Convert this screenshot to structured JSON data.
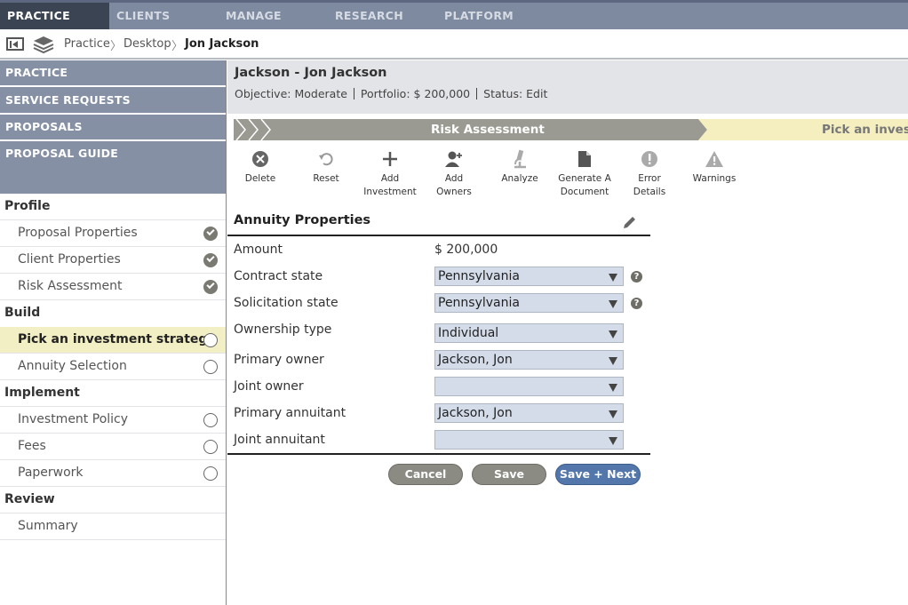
{
  "topnav": {
    "tabs": [
      {
        "label": "PRACTICE"
      },
      {
        "label": "CLIENTS"
      },
      {
        "label": "MANAGE"
      },
      {
        "label": "RESEARCH"
      },
      {
        "label": "PLATFORM"
      }
    ]
  },
  "breadcrumb": {
    "items": [
      "Practice",
      "Desktop",
      "Jon Jackson"
    ]
  },
  "sidebar": {
    "heads": [
      "PRACTICE",
      "SERVICE REQUESTS",
      "PROPOSALS",
      "PROPOSAL GUIDE"
    ],
    "sections": {
      "profile": "Profile",
      "build": "Build",
      "implement": "Implement",
      "review": "Review"
    },
    "items": [
      {
        "label": "Proposal Properties",
        "status": "done"
      },
      {
        "label": "Client Properties",
        "status": "done"
      },
      {
        "label": "Risk Assessment",
        "status": "done"
      },
      {
        "label": "Pick an investment strategy",
        "status": "empty"
      },
      {
        "label": "Annuity Selection",
        "status": "empty"
      },
      {
        "label": "Investment Policy",
        "status": "empty"
      },
      {
        "label": "Fees",
        "status": "empty"
      },
      {
        "label": "Paperwork",
        "status": "empty"
      },
      {
        "label": "Summary",
        "status": "none"
      }
    ]
  },
  "header": {
    "title": "Jackson - Jon Jackson",
    "objective": "Objective: Moderate",
    "portfolio": "Portfolio: $ 200,000",
    "status": "Status: Edit"
  },
  "progress": {
    "done_step": "Risk Assessment",
    "current_step": "Pick an invest"
  },
  "toolbar": {
    "delete": "Delete",
    "reset": "Reset",
    "add_investment": "Add Investment",
    "add_owners": "Add Owners",
    "analyze": "Analyze",
    "generate_document": "Generate A Document",
    "error_details": "Error Details",
    "warnings": "Warnings"
  },
  "form": {
    "title": "Annuity Properties",
    "amount_label": "Amount",
    "amount_value": "$ 200,000",
    "contract_state_label": "Contract state",
    "contract_state_value": "Pennsylvania",
    "solicitation_state_label": "Solicitation state",
    "solicitation_state_value": "Pennsylvania",
    "ownership_type_label": "Ownership type",
    "ownership_type_value": "Individual",
    "primary_owner_label": "Primary owner",
    "primary_owner_value": "Jackson, Jon",
    "joint_owner_label": "Joint owner",
    "joint_owner_value": "",
    "primary_annuitant_label": "Primary annuitant",
    "primary_annuitant_value": "Jackson, Jon",
    "joint_annuitant_label": "Joint annuitant",
    "joint_annuitant_value": "",
    "help_glyph": "?"
  },
  "buttons": {
    "cancel": "Cancel",
    "save": "Save",
    "save_next": "Save + Next"
  },
  "colors": {
    "nav_bg": "#7d8aa0",
    "nav_active": "#3b4453",
    "sidebar_head": "#8590a4",
    "active_step": "#f3efc4",
    "select_bg": "#d4dcea",
    "primary_button": "#5477ab"
  }
}
